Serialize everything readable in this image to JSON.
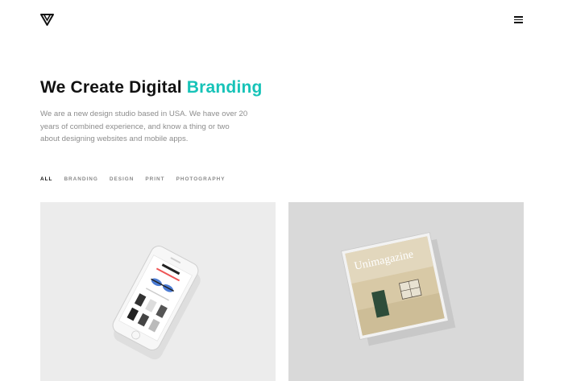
{
  "header": {
    "logo_icon": "triangle-logo-icon",
    "menu_icon": "hamburger-icon"
  },
  "hero": {
    "title_main": "We Create Digital",
    "title_accent": "Branding",
    "accent_color": "#17c3b8",
    "description": "We are a new design studio based in USA. We have over 20 years of combined experience, and know a thing or two about designing websites and mobile apps."
  },
  "filters": [
    "ALL",
    "BRANDING",
    "DESIGN",
    "PRINT",
    "PHOTOGRAPHY"
  ],
  "portfolio": {
    "magazine_title": "Unimagazine"
  }
}
